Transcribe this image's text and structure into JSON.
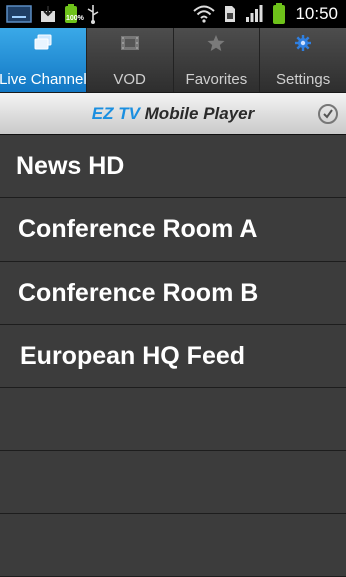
{
  "status_bar": {
    "battery_percent_label": "100%",
    "time": "10:50",
    "left_icons": [
      "notification-screen-icon",
      "download-icon",
      "battery-full-icon",
      "usb-icon"
    ],
    "right_icons": [
      "wifi-icon",
      "sim-icon",
      "signal-icon",
      "battery-icon"
    ]
  },
  "tabs": [
    {
      "label": "Live Channel",
      "icon": "live-channel-icon",
      "active": true
    },
    {
      "label": "VOD",
      "icon": "film-icon",
      "active": false
    },
    {
      "label": "Favorites",
      "icon": "star-icon",
      "active": false
    },
    {
      "label": "Settings",
      "icon": "gear-icon",
      "active": false
    }
  ],
  "header": {
    "brand_ez": "EZ TV",
    "brand_rest": " Mobile Player"
  },
  "channels": [
    {
      "label": "News HD"
    },
    {
      "label": "Conference Room A"
    },
    {
      "label": "Conference Room B"
    },
    {
      "label": "European HQ Feed"
    }
  ],
  "colors": {
    "accent": "#1b8fe0",
    "list_background": "#3c3c3c",
    "divider": "#1d1d1d"
  }
}
